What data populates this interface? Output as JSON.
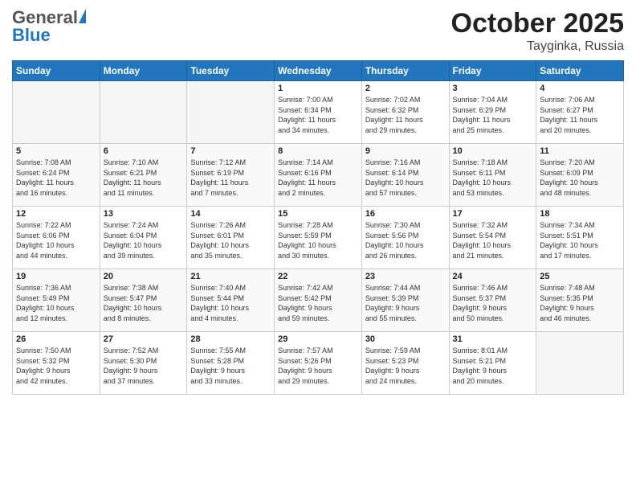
{
  "header": {
    "logo_general": "General",
    "logo_blue": "Blue",
    "month": "October 2025",
    "location": "Tayginka, Russia"
  },
  "weekdays": [
    "Sunday",
    "Monday",
    "Tuesday",
    "Wednesday",
    "Thursday",
    "Friday",
    "Saturday"
  ],
  "weeks": [
    [
      {
        "day": "",
        "info": ""
      },
      {
        "day": "",
        "info": ""
      },
      {
        "day": "",
        "info": ""
      },
      {
        "day": "1",
        "info": "Sunrise: 7:00 AM\nSunset: 6:34 PM\nDaylight: 11 hours\nand 34 minutes."
      },
      {
        "day": "2",
        "info": "Sunrise: 7:02 AM\nSunset: 6:32 PM\nDaylight: 11 hours\nand 29 minutes."
      },
      {
        "day": "3",
        "info": "Sunrise: 7:04 AM\nSunset: 6:29 PM\nDaylight: 11 hours\nand 25 minutes."
      },
      {
        "day": "4",
        "info": "Sunrise: 7:06 AM\nSunset: 6:27 PM\nDaylight: 11 hours\nand 20 minutes."
      }
    ],
    [
      {
        "day": "5",
        "info": "Sunrise: 7:08 AM\nSunset: 6:24 PM\nDaylight: 11 hours\nand 16 minutes."
      },
      {
        "day": "6",
        "info": "Sunrise: 7:10 AM\nSunset: 6:21 PM\nDaylight: 11 hours\nand 11 minutes."
      },
      {
        "day": "7",
        "info": "Sunrise: 7:12 AM\nSunset: 6:19 PM\nDaylight: 11 hours\nand 7 minutes."
      },
      {
        "day": "8",
        "info": "Sunrise: 7:14 AM\nSunset: 6:16 PM\nDaylight: 11 hours\nand 2 minutes."
      },
      {
        "day": "9",
        "info": "Sunrise: 7:16 AM\nSunset: 6:14 PM\nDaylight: 10 hours\nand 57 minutes."
      },
      {
        "day": "10",
        "info": "Sunrise: 7:18 AM\nSunset: 6:11 PM\nDaylight: 10 hours\nand 53 minutes."
      },
      {
        "day": "11",
        "info": "Sunrise: 7:20 AM\nSunset: 6:09 PM\nDaylight: 10 hours\nand 48 minutes."
      }
    ],
    [
      {
        "day": "12",
        "info": "Sunrise: 7:22 AM\nSunset: 6:06 PM\nDaylight: 10 hours\nand 44 minutes."
      },
      {
        "day": "13",
        "info": "Sunrise: 7:24 AM\nSunset: 6:04 PM\nDaylight: 10 hours\nand 39 minutes."
      },
      {
        "day": "14",
        "info": "Sunrise: 7:26 AM\nSunset: 6:01 PM\nDaylight: 10 hours\nand 35 minutes."
      },
      {
        "day": "15",
        "info": "Sunrise: 7:28 AM\nSunset: 5:59 PM\nDaylight: 10 hours\nand 30 minutes."
      },
      {
        "day": "16",
        "info": "Sunrise: 7:30 AM\nSunset: 5:56 PM\nDaylight: 10 hours\nand 26 minutes."
      },
      {
        "day": "17",
        "info": "Sunrise: 7:32 AM\nSunset: 5:54 PM\nDaylight: 10 hours\nand 21 minutes."
      },
      {
        "day": "18",
        "info": "Sunrise: 7:34 AM\nSunset: 5:51 PM\nDaylight: 10 hours\nand 17 minutes."
      }
    ],
    [
      {
        "day": "19",
        "info": "Sunrise: 7:36 AM\nSunset: 5:49 PM\nDaylight: 10 hours\nand 12 minutes."
      },
      {
        "day": "20",
        "info": "Sunrise: 7:38 AM\nSunset: 5:47 PM\nDaylight: 10 hours\nand 8 minutes."
      },
      {
        "day": "21",
        "info": "Sunrise: 7:40 AM\nSunset: 5:44 PM\nDaylight: 10 hours\nand 4 minutes."
      },
      {
        "day": "22",
        "info": "Sunrise: 7:42 AM\nSunset: 5:42 PM\nDaylight: 9 hours\nand 59 minutes."
      },
      {
        "day": "23",
        "info": "Sunrise: 7:44 AM\nSunset: 5:39 PM\nDaylight: 9 hours\nand 55 minutes."
      },
      {
        "day": "24",
        "info": "Sunrise: 7:46 AM\nSunset: 5:37 PM\nDaylight: 9 hours\nand 50 minutes."
      },
      {
        "day": "25",
        "info": "Sunrise: 7:48 AM\nSunset: 5:35 PM\nDaylight: 9 hours\nand 46 minutes."
      }
    ],
    [
      {
        "day": "26",
        "info": "Sunrise: 7:50 AM\nSunset: 5:32 PM\nDaylight: 9 hours\nand 42 minutes."
      },
      {
        "day": "27",
        "info": "Sunrise: 7:52 AM\nSunset: 5:30 PM\nDaylight: 9 hours\nand 37 minutes."
      },
      {
        "day": "28",
        "info": "Sunrise: 7:55 AM\nSunset: 5:28 PM\nDaylight: 9 hours\nand 33 minutes."
      },
      {
        "day": "29",
        "info": "Sunrise: 7:57 AM\nSunset: 5:26 PM\nDaylight: 9 hours\nand 29 minutes."
      },
      {
        "day": "30",
        "info": "Sunrise: 7:59 AM\nSunset: 5:23 PM\nDaylight: 9 hours\nand 24 minutes."
      },
      {
        "day": "31",
        "info": "Sunrise: 8:01 AM\nSunset: 5:21 PM\nDaylight: 9 hours\nand 20 minutes."
      },
      {
        "day": "",
        "info": ""
      }
    ]
  ]
}
